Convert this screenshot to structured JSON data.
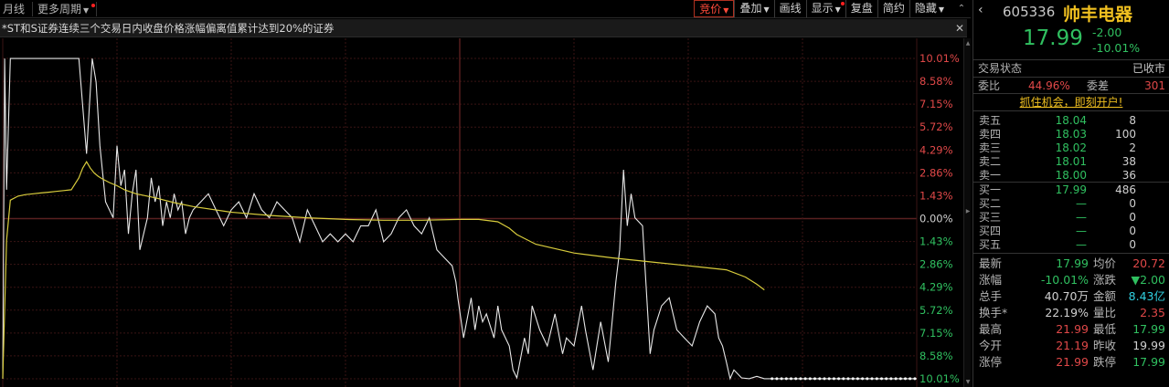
{
  "toolbar": {
    "left_items": [
      "月线",
      "更多周期"
    ],
    "right_buttons": [
      "竞价",
      "叠加",
      "画线",
      "显示",
      "复盘",
      "简约",
      "隐藏"
    ],
    "active_button": "竞价",
    "scroll_up_glyph": "⌃"
  },
  "notice": {
    "text": "*ST和S证券连续三个交易日内收盘价格涨幅偏离值累计达到20%的证券",
    "close_glyph": "✕"
  },
  "chart_data": {
    "type": "line",
    "title": "",
    "xlabel": "",
    "ylabel": "",
    "prev_close": 19.99,
    "ylim_pct": [
      -10.01,
      10.01
    ],
    "y_ticks": [
      "10.01%",
      "8.58%",
      "7.15%",
      "5.72%",
      "4.29%",
      "2.86%",
      "1.43%",
      "0.00%",
      "1.43%",
      "2.86%",
      "4.29%",
      "5.72%",
      "7.15%",
      "8.58%",
      "10.01%"
    ],
    "grid": true,
    "session_minutes": 240,
    "series": [
      {
        "color": "#e8e8e8",
        "x": [
          0,
          0.5,
          1,
          1.5,
          2,
          8,
          16,
          20,
          22,
          23.5,
          24.5,
          25.5,
          27,
          29,
          30,
          31,
          32,
          33,
          34,
          35,
          36,
          38,
          39,
          40,
          41,
          42,
          43,
          44,
          45,
          46,
          47,
          48,
          49,
          50,
          52,
          54,
          56,
          58,
          60,
          62,
          64,
          66,
          68,
          70,
          72,
          74,
          76,
          78,
          80,
          82,
          84,
          86,
          88,
          90,
          92,
          94,
          96,
          98,
          100,
          102,
          104,
          106,
          108,
          110,
          112,
          114,
          116,
          118,
          119,
          119.5,
          121,
          123,
          124,
          125,
          126,
          127,
          129,
          130,
          131,
          133,
          134,
          135,
          137,
          138,
          139,
          141,
          143,
          145,
          147,
          148,
          150,
          152,
          153,
          155,
          157,
          159,
          160,
          161,
          162,
          163,
          164,
          165,
          166,
          168,
          170,
          171,
          173,
          175,
          177,
          179,
          181,
          183,
          185,
          187,
          188,
          189,
          190,
          191,
          192,
          194,
          196,
          198,
          200,
          240
        ],
        "y": [
          17.99,
          21.99,
          20.35,
          21.19,
          21.99,
          21.99,
          21.99,
          21.99,
          20.8,
          21.99,
          21.7,
          20.9,
          20.2,
          20.0,
          20.9,
          20.4,
          20.6,
          19.8,
          20.3,
          20.6,
          19.6,
          20.0,
          20.5,
          20.2,
          20.4,
          19.9,
          20.2,
          20.0,
          20.3,
          20.1,
          20.2,
          19.8,
          20.0,
          20.1,
          20.2,
          20.3,
          20.1,
          19.9,
          20.1,
          20.2,
          20.0,
          20.3,
          20.1,
          20.0,
          20.2,
          20.1,
          20.0,
          19.7,
          20.1,
          19.9,
          19.7,
          19.8,
          19.7,
          19.8,
          19.7,
          19.9,
          19.9,
          20.1,
          19.7,
          19.8,
          20.0,
          20.1,
          19.9,
          19.8,
          20.0,
          19.6,
          19.5,
          19.4,
          19.2,
          19.0,
          18.5,
          19.0,
          18.6,
          18.9,
          18.7,
          18.8,
          18.5,
          18.9,
          18.6,
          18.4,
          18.1,
          18.0,
          18.5,
          18.3,
          18.9,
          18.6,
          18.4,
          18.8,
          18.3,
          18.5,
          18.4,
          18.9,
          18.6,
          18.1,
          18.7,
          18.2,
          18.7,
          19.2,
          19.6,
          20.6,
          19.9,
          20.3,
          20.0,
          19.9,
          18.3,
          18.6,
          18.9,
          19.0,
          18.6,
          18.5,
          18.4,
          18.7,
          18.9,
          18.8,
          18.5,
          18.4,
          18.2,
          17.99,
          18.1,
          18.0,
          17.99,
          18.02,
          17.99,
          17.99
        ]
      },
      {
        "color": "#d8cc3c",
        "x": [
          0,
          1,
          2,
          4,
          6,
          8,
          10,
          12,
          14,
          16,
          18,
          20,
          21,
          22,
          23,
          24,
          25,
          26,
          28,
          30,
          32,
          35,
          40,
          45,
          50,
          60,
          70,
          80,
          90,
          100,
          110,
          120,
          125,
          130,
          133,
          135,
          140,
          150,
          160,
          170,
          180,
          190,
          195,
          198,
          200
        ],
        "y": [
          17.99,
          19.72,
          20.22,
          20.27,
          20.29,
          20.3,
          20.31,
          20.32,
          20.33,
          20.34,
          20.35,
          20.5,
          20.62,
          20.7,
          20.62,
          20.56,
          20.52,
          20.49,
          20.44,
          20.4,
          20.35,
          20.3,
          20.25,
          20.19,
          20.14,
          20.07,
          20.03,
          20.0,
          19.98,
          19.97,
          19.97,
          19.98,
          19.98,
          19.95,
          19.87,
          19.79,
          19.67,
          19.56,
          19.5,
          19.45,
          19.4,
          19.35,
          19.26,
          19.17,
          19.1
        ]
      }
    ]
  },
  "panel": {
    "back_glyph": "‹",
    "code": "605336",
    "name": "帅丰电器",
    "last": "17.99",
    "change": "-2.00",
    "change_pct": "-10.01%",
    "status_label": "交易状态",
    "status_value": "已收市",
    "weibi_label": "委比",
    "weibi_value": "44.96%",
    "weicha_label": "委差",
    "weicha_value": "301",
    "cta": "抓住机会，即刻开户!",
    "asks": [
      {
        "label": "卖五",
        "price": "18.04",
        "vol": "8"
      },
      {
        "label": "卖四",
        "price": "18.03",
        "vol": "100"
      },
      {
        "label": "卖三",
        "price": "18.02",
        "vol": "2"
      },
      {
        "label": "卖二",
        "price": "18.01",
        "vol": "38"
      },
      {
        "label": "卖一",
        "price": "18.00",
        "vol": "36"
      }
    ],
    "bids": [
      {
        "label": "买一",
        "price": "17.99",
        "vol": "486"
      },
      {
        "label": "买二",
        "price": "—",
        "vol": "0"
      },
      {
        "label": "买三",
        "price": "—",
        "vol": "0"
      },
      {
        "label": "买四",
        "price": "—",
        "vol": "0"
      },
      {
        "label": "买五",
        "price": "—",
        "vol": "0"
      }
    ],
    "stats": [
      {
        "k1": "最新",
        "v1": "17.99",
        "c1": "#30c060",
        "k2": "均价",
        "v2": "20.72",
        "c2": "#e04848"
      },
      {
        "k1": "涨幅",
        "v1": "-10.01%",
        "c1": "#30c060",
        "k2": "涨跌",
        "v2": "▼2.00",
        "c2": "#30c060"
      },
      {
        "k1": "总手",
        "v1": "40.70万",
        "c1": "#d0d0d0",
        "k2": "金额",
        "v2": "8.43亿",
        "c2": "#30d0e0"
      },
      {
        "k1": "换手*",
        "v1": "22.19%",
        "c1": "#d0d0d0",
        "k2": "量比",
        "v2": "2.35",
        "c2": "#e04848"
      },
      {
        "k1": "最高",
        "v1": "21.99",
        "c1": "#e04848",
        "k2": "最低",
        "v2": "17.99",
        "c2": "#30c060"
      },
      {
        "k1": "今开",
        "v1": "21.19",
        "c1": "#e04848",
        "k2": "昨收",
        "v2": "19.99",
        "c2": "#d0d0d0"
      },
      {
        "k1": "涨停",
        "v1": "21.99",
        "c1": "#e04848",
        "k2": "跌停",
        "v2": "17.99",
        "c2": "#30c060"
      }
    ]
  }
}
